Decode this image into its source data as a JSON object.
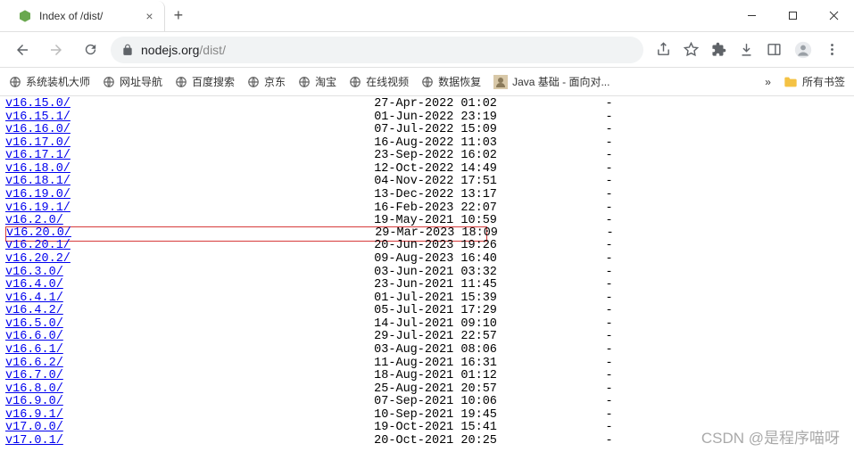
{
  "tab": {
    "title": "Index of /dist/",
    "favicon_color": "#6aa84f"
  },
  "url": {
    "host": "nodejs.org",
    "path": "/dist/"
  },
  "bookmarks": [
    {
      "label": "系统装机大师"
    },
    {
      "label": "网址导航"
    },
    {
      "label": "百度搜索"
    },
    {
      "label": "京东"
    },
    {
      "label": "淘宝"
    },
    {
      "label": "在线视频"
    },
    {
      "label": "数据恢复"
    },
    {
      "label": "Java 基础 - 面向对...",
      "special": true
    }
  ],
  "bm_overflow": "»",
  "bm_all": "所有书签",
  "listing": [
    {
      "name": "v16.15.0/",
      "date": "27-Apr-2022 01:02",
      "size": "-"
    },
    {
      "name": "v16.15.1/",
      "date": "01-Jun-2022 23:19",
      "size": "-"
    },
    {
      "name": "v16.16.0/",
      "date": "07-Jul-2022 15:09",
      "size": "-"
    },
    {
      "name": "v16.17.0/",
      "date": "16-Aug-2022 11:03",
      "size": "-"
    },
    {
      "name": "v16.17.1/",
      "date": "23-Sep-2022 16:02",
      "size": "-"
    },
    {
      "name": "v16.18.0/",
      "date": "12-Oct-2022 14:49",
      "size": "-"
    },
    {
      "name": "v16.18.1/",
      "date": "04-Nov-2022 17:51",
      "size": "-"
    },
    {
      "name": "v16.19.0/",
      "date": "13-Dec-2022 13:17",
      "size": "-"
    },
    {
      "name": "v16.19.1/",
      "date": "16-Feb-2023 22:07",
      "size": "-"
    },
    {
      "name": "v16.2.0/",
      "date": "19-May-2021 10:59",
      "size": "-"
    },
    {
      "name": "v16.20.0/",
      "date": "29-Mar-2023 18:09",
      "size": "-",
      "highlight": true
    },
    {
      "name": "v16.20.1/",
      "date": "20-Jun-2023 19:26",
      "size": "-"
    },
    {
      "name": "v16.20.2/",
      "date": "09-Aug-2023 16:40",
      "size": "-"
    },
    {
      "name": "v16.3.0/",
      "date": "03-Jun-2021 03:32",
      "size": "-"
    },
    {
      "name": "v16.4.0/",
      "date": "23-Jun-2021 11:45",
      "size": "-"
    },
    {
      "name": "v16.4.1/",
      "date": "01-Jul-2021 15:39",
      "size": "-"
    },
    {
      "name": "v16.4.2/",
      "date": "05-Jul-2021 17:29",
      "size": "-"
    },
    {
      "name": "v16.5.0/",
      "date": "14-Jul-2021 09:10",
      "size": "-"
    },
    {
      "name": "v16.6.0/",
      "date": "29-Jul-2021 22:57",
      "size": "-"
    },
    {
      "name": "v16.6.1/",
      "date": "03-Aug-2021 08:06",
      "size": "-"
    },
    {
      "name": "v16.6.2/",
      "date": "11-Aug-2021 16:31",
      "size": "-"
    },
    {
      "name": "v16.7.0/",
      "date": "18-Aug-2021 01:12",
      "size": "-"
    },
    {
      "name": "v16.8.0/",
      "date": "25-Aug-2021 20:57",
      "size": "-"
    },
    {
      "name": "v16.9.0/",
      "date": "07-Sep-2021 10:06",
      "size": "-"
    },
    {
      "name": "v16.9.1/",
      "date": "10-Sep-2021 19:45",
      "size": "-"
    },
    {
      "name": "v17.0.0/",
      "date": "19-Oct-2021 15:41",
      "size": "-"
    },
    {
      "name": "v17.0.1/",
      "date": "20-Oct-2021 20:25",
      "size": "-"
    }
  ],
  "name_col_width": 51,
  "date_col_width": 32,
  "watermark": "CSDN @是程序喵呀"
}
